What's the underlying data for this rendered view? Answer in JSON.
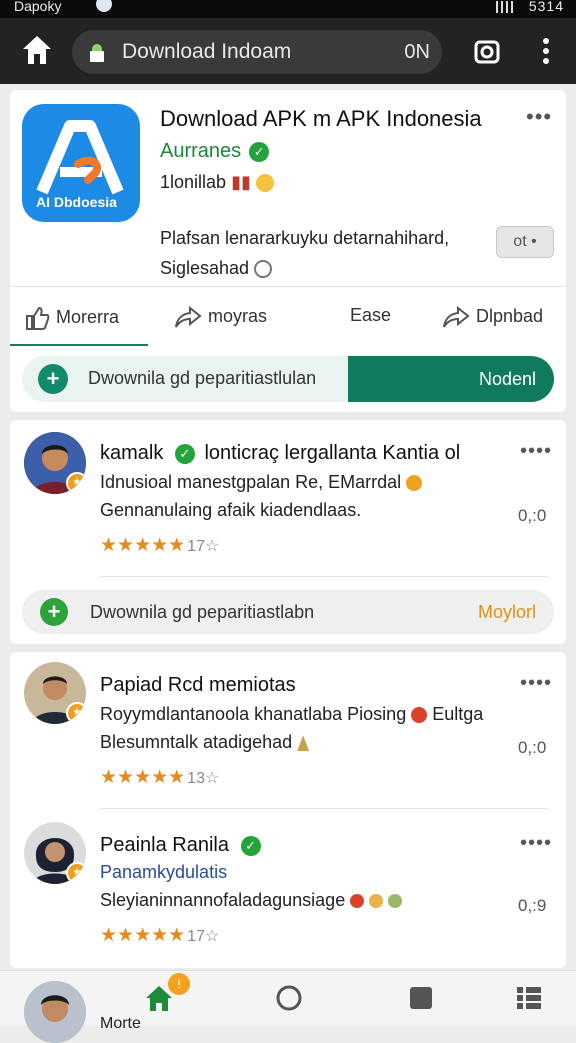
{
  "status_bar": {
    "carrier": "Dapoky",
    "clock": "5314"
  },
  "browser": {
    "url": "Download Indoam",
    "toggle": "0N"
  },
  "app": {
    "title": "Download APK m APK Indonesia",
    "developer": "Aurranes",
    "meta": "1lonillab",
    "icon_text": "AI Dbdoesia",
    "description_line1": "Plafsan lenararkuyku detarnahihard,",
    "description_line2": "Siglesahad",
    "chip": "ot",
    "actions": [
      "Morerra",
      "moyras",
      "Ease",
      "Dlpnbad"
    ]
  },
  "download_bar": {
    "text": "Dwownila gd  peparitiastlulan",
    "button": "Nodenl"
  },
  "reviews_card1": [
    {
      "name": "kamalk",
      "name_suffix": "lonticraç lergallanta Kantia ol",
      "line1": "Idnusioal manestgpalan Re, EMarrdal",
      "line2": "Gennanulaing afaik kiadendlaas.",
      "time": "0,:0",
      "stars": "★★★★★",
      "count": "17☆"
    }
  ],
  "download_bar2": {
    "text": "Dwownila gd  peparitiastlabn",
    "button": "Moylorl"
  },
  "reviews_card2": [
    {
      "name": "Papiad Rcd memiotas",
      "line1": "Royymdlantanoola khanatlaba Piosing",
      "line1_suffix": "Eultga",
      "line2": "Blesumntalk atadigehad",
      "time": "0,:0",
      "stars": "★★★★★",
      "count": "13☆"
    },
    {
      "name": "Peainla Ranila",
      "line1": "Panamkydulatis",
      "line2": "Sleyianinnannofaladagunsiage",
      "time": "0,:9",
      "stars": "★★★★★",
      "count": "17☆"
    }
  ],
  "bottom_nav": {
    "label": "Morte",
    "badge": "!"
  },
  "colors": {
    "accent": "#0f7a5e",
    "verified": "#23a339",
    "star": "#e38b1e",
    "app_icon": "#1d8be6"
  }
}
